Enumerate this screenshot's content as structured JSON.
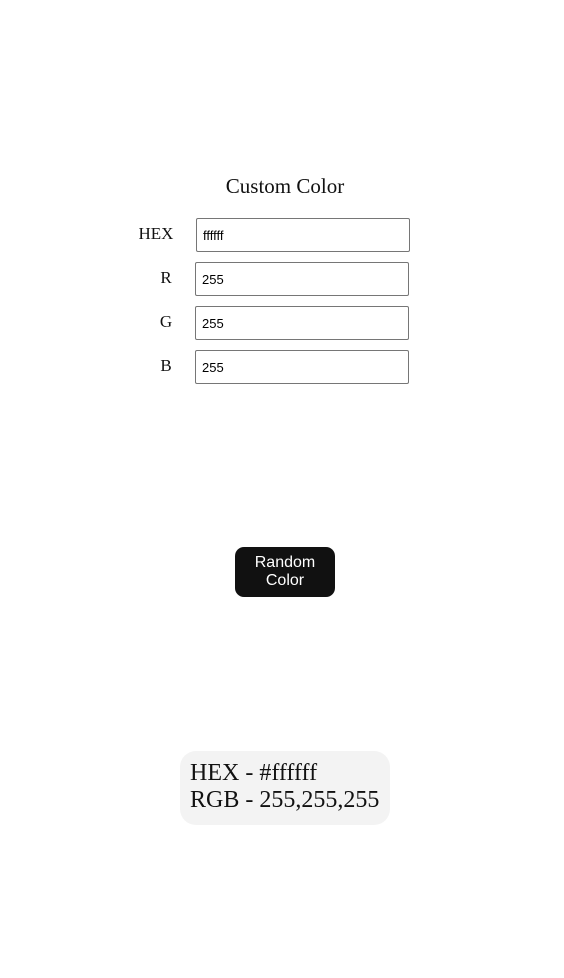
{
  "custom_color": {
    "title": "Custom Color",
    "fields": {
      "hex": {
        "label": "HEX",
        "value": "ffffff"
      },
      "r": {
        "label": "R",
        "value": "255"
      },
      "g": {
        "label": "G",
        "value": "255"
      },
      "b": {
        "label": "B",
        "value": "255"
      }
    }
  },
  "random_button": {
    "label": "Random Color"
  },
  "result": {
    "hex_line": "HEX - #ffffff",
    "rgb_line": "RGB - 255,255,255"
  },
  "colors": {
    "button_background": "#111111",
    "button_text": "#ffffff",
    "result_background": "#f3f3f3",
    "input_border": "#767676"
  }
}
